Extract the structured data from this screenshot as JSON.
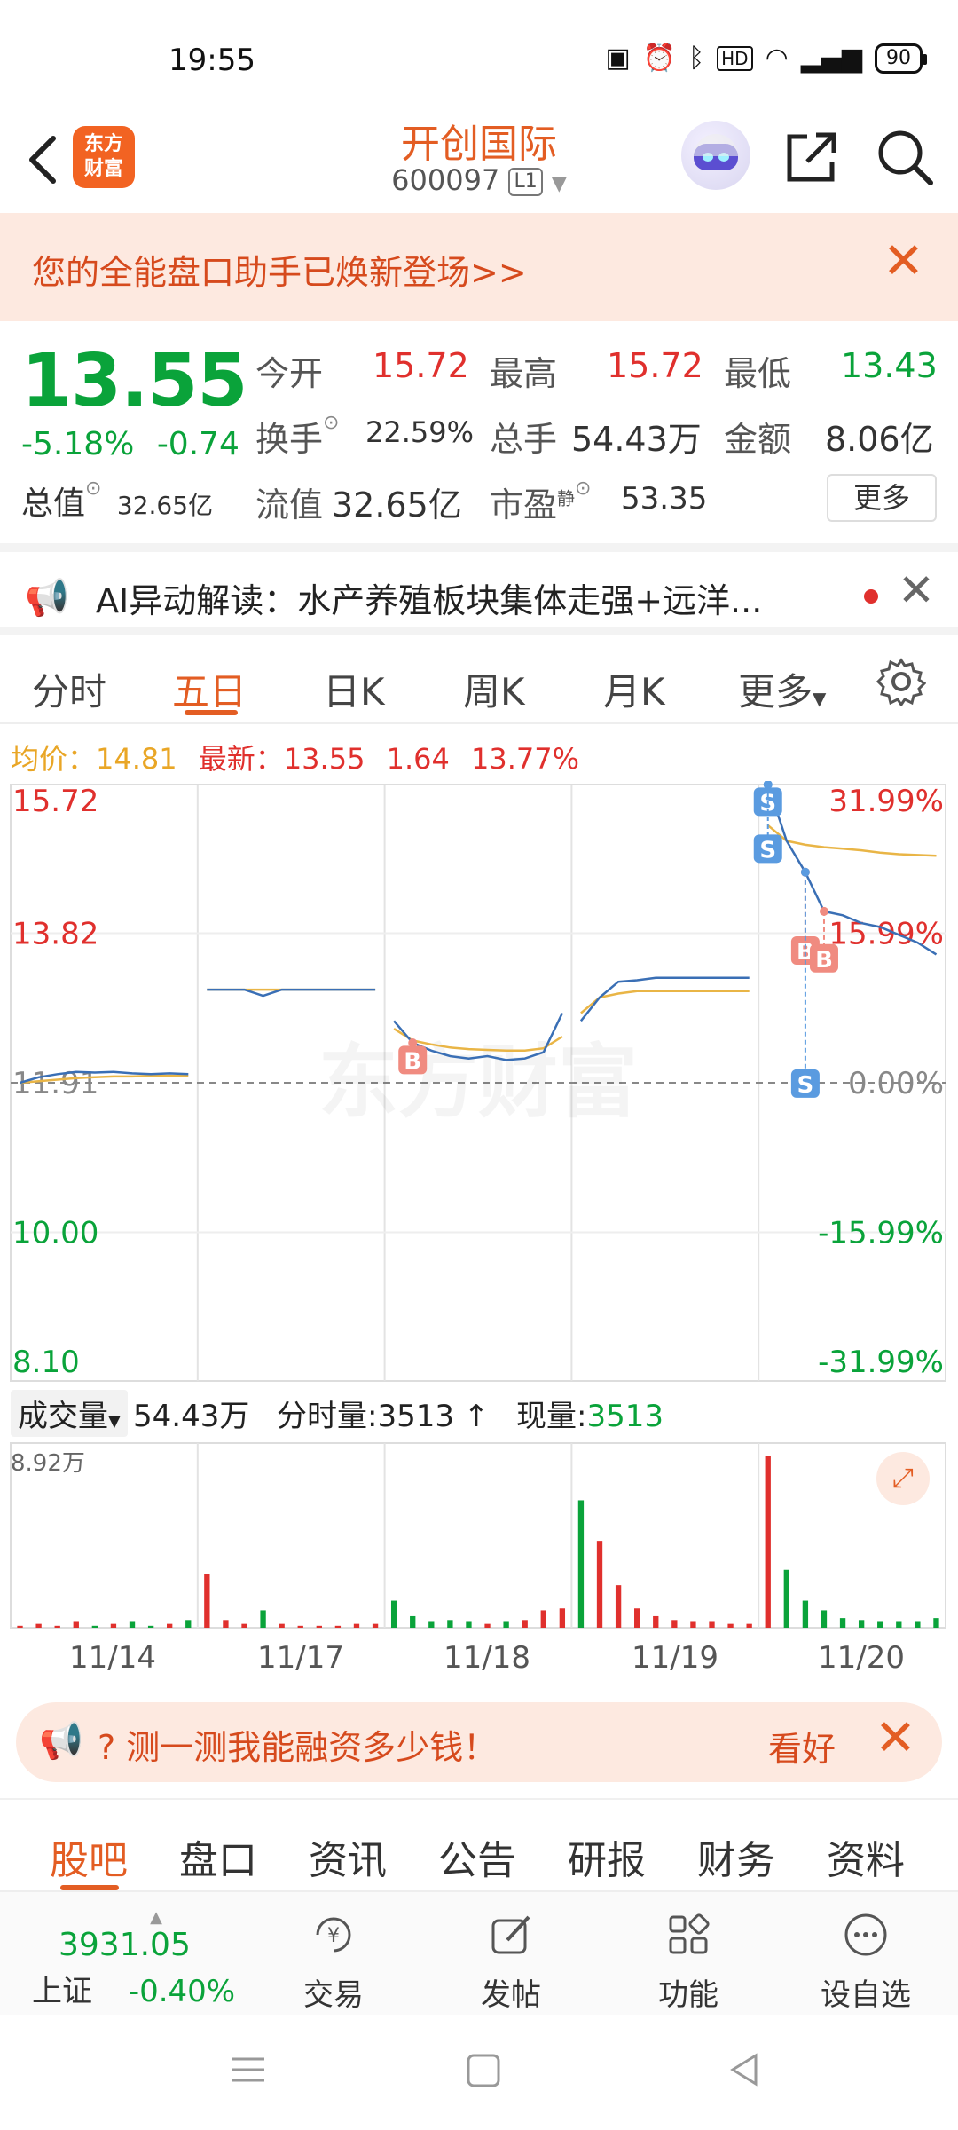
{
  "status": {
    "time": "19:55",
    "battery": "90"
  },
  "header": {
    "brand_line1": "东方",
    "brand_line2": "财富",
    "stock_name": "开创国际",
    "stock_code": "600097",
    "level": "L1"
  },
  "banner": {
    "text": "您的全能盘口助手已焕新登场>>"
  },
  "quote": {
    "price": "13.55",
    "change_pct": "-5.18%",
    "change": "-0.74",
    "open_label": "今开",
    "open": "15.72",
    "high_label": "最高",
    "high": "15.72",
    "low_label": "最低",
    "low": "13.43",
    "turnover_label": "换手",
    "turnover": "22.59%",
    "volume_label": "总手",
    "volume": "54.43万",
    "amount_label": "金额",
    "amount": "8.06亿",
    "mktcap_label": "总值",
    "mktcap": "32.65亿",
    "float_label": "流值",
    "float": "32.65亿",
    "pe_label": "市盈",
    "pe_sup": "静",
    "pe": "53.35",
    "more": "更多"
  },
  "ai": {
    "text": "AI异动解读：水产养殖板块集体走强+远洋..."
  },
  "chart_tabs": [
    "分时",
    "五日",
    "日K",
    "周K",
    "月K",
    "更多"
  ],
  "avg_line": {
    "avg_label": "均价：",
    "avg": "14.81",
    "latest_label": "最新：",
    "latest": "13.55",
    "extra1": "1.64",
    "extra2": "13.77%"
  },
  "chart_data": {
    "type": "line",
    "title": "",
    "x": [
      "11/14",
      "11/17",
      "11/18",
      "11/19",
      "11/20"
    ],
    "y_ticks_left": [
      "15.72",
      "13.82",
      "11.91",
      "10.00",
      "8.10"
    ],
    "y_ticks_right": [
      "31.99%",
      "15.99%",
      "0.00%",
      "-15.99%",
      "-31.99%"
    ],
    "ylim": [
      8.1,
      15.72
    ],
    "prev_close": 11.91,
    "watermark": "东方财富",
    "series": [
      {
        "name": "价格",
        "color": "#3a6fb5",
        "values": [
          11.91,
          11.98,
          12.02,
          12.05,
          12.04,
          12.05,
          12.03,
          12.02,
          12.03,
          12.02,
          13.1,
          13.1,
          13.1,
          13.02,
          13.1,
          13.1,
          13.1,
          13.1,
          13.1,
          13.1,
          12.7,
          12.42,
          12.32,
          12.25,
          12.22,
          12.25,
          12.2,
          12.22,
          12.3,
          12.8,
          12.7,
          13.0,
          13.2,
          13.22,
          13.25,
          13.25,
          13.25,
          13.25,
          13.25,
          13.25,
          15.72,
          15.0,
          14.6,
          14.1,
          14.05,
          13.95,
          13.9,
          13.8,
          13.7,
          13.55
        ]
      },
      {
        "name": "均价",
        "color": "#e9b546",
        "values": [
          11.91,
          11.93,
          11.95,
          11.97,
          11.98,
          11.99,
          11.99,
          12.0,
          12.0,
          12.0,
          13.1,
          13.1,
          13.1,
          13.1,
          13.1,
          13.1,
          13.1,
          13.1,
          13.1,
          13.1,
          12.6,
          12.45,
          12.4,
          12.36,
          12.34,
          12.33,
          12.32,
          12.32,
          12.35,
          12.5,
          12.8,
          13.0,
          13.05,
          13.08,
          13.08,
          13.08,
          13.08,
          13.08,
          13.08,
          13.08,
          15.2,
          15.0,
          14.95,
          14.92,
          14.9,
          14.88,
          14.85,
          14.83,
          14.82,
          14.81
        ]
      }
    ],
    "markers": [
      {
        "label": "B",
        "type": "buy",
        "x": "11/18"
      },
      {
        "label": "S",
        "type": "sell",
        "x": "11/19"
      },
      {
        "label": "B",
        "type": "buy",
        "x": "11/19"
      },
      {
        "label": "B",
        "type": "buy",
        "x": "11/19"
      },
      {
        "label": "S",
        "type": "sell",
        "x": "11/20"
      },
      {
        "label": "S",
        "type": "sell",
        "x": "11/20"
      }
    ],
    "volume": {
      "max_label": "8.92万",
      "values": [
        0.1,
        0.2,
        0.1,
        0.3,
        0.1,
        0.2,
        0.3,
        0.1,
        0.2,
        0.4,
        2.8,
        0.4,
        0.2,
        0.9,
        0.2,
        0.1,
        0.1,
        0.1,
        0.2,
        0.2,
        1.4,
        0.6,
        0.3,
        0.4,
        0.3,
        0.2,
        0.3,
        0.4,
        0.9,
        1.0,
        6.6,
        4.5,
        2.2,
        1.0,
        0.6,
        0.4,
        0.3,
        0.3,
        0.2,
        0.2,
        8.92,
        3.0,
        1.4,
        0.9,
        0.5,
        0.4,
        0.3,
        0.3,
        0.3,
        0.5
      ]
    }
  },
  "volume_header": {
    "label": "成交量",
    "volume": "54.43万",
    "minute_label": "分时量:",
    "minute_vol": "3513",
    "now_label": "现量:",
    "now_vol": "3513"
  },
  "promo": {
    "text": "?  测一测我能融资多少钱！",
    "see": "看好"
  },
  "section_tabs": [
    "股吧",
    "盘口",
    "资讯",
    "公告",
    "研报",
    "财务",
    "资料"
  ],
  "bottom_bar": {
    "index_value": "3931.05",
    "index_name": "上证",
    "index_change": "-0.40%",
    "trade": "交易",
    "post": "发帖",
    "func": "功能",
    "watch": "设自选"
  },
  "colors": {
    "accent": "#e35d23",
    "up": "#e0302d",
    "down": "#0aa33a",
    "price_line": "#3a6fb5",
    "avg_line": "#e9b546"
  }
}
